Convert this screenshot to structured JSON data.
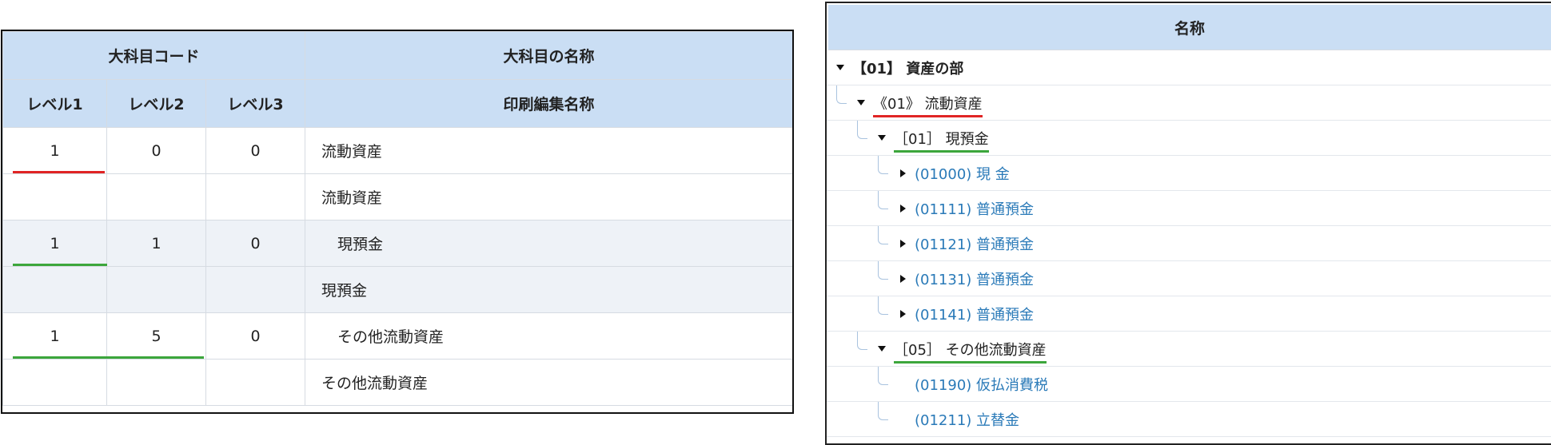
{
  "left_table": {
    "header_group": "大科目コード",
    "header_name": "大科目の名称",
    "level_headers": [
      "レベル1",
      "レベル2",
      "レベル3"
    ],
    "print_name_header": "印刷編集名称",
    "rows": [
      {
        "l1": "1",
        "l2": "0",
        "l3": "0",
        "name": "流動資産"
      },
      {
        "l1": "",
        "l2": "",
        "l3": "",
        "name": "流動資産"
      },
      {
        "l1": "1",
        "l2": "1",
        "l3": "0",
        "name": "現預金"
      },
      {
        "l1": "",
        "l2": "",
        "l3": "",
        "name": "現預金"
      },
      {
        "l1": "1",
        "l2": "5",
        "l3": "0",
        "name": "その他流動資産"
      },
      {
        "l1": "",
        "l2": "",
        "l3": "",
        "name": "その他流動資産"
      }
    ]
  },
  "tree": {
    "header": "名称",
    "nodes": [
      {
        "text": "【01】 資産の部",
        "caret": "down"
      },
      {
        "text": "《01》 流動資産",
        "caret": "down"
      },
      {
        "text": "［01］ 現預金",
        "caret": "down"
      },
      {
        "text": "(01000) 現 金",
        "caret": "right"
      },
      {
        "text": "(01111) 普通預金",
        "caret": "right"
      },
      {
        "text": "(01121) 普通預金",
        "caret": "right"
      },
      {
        "text": "(01131) 普通預金",
        "caret": "right"
      },
      {
        "text": "(01141) 普通預金",
        "caret": "right"
      },
      {
        "text": "［05］ その他流動資産",
        "caret": "down"
      },
      {
        "text": "(01190) 仮払消費税",
        "caret": "none"
      },
      {
        "text": "(01211) 立替金",
        "caret": "none"
      }
    ]
  },
  "colors": {
    "header_bg": "#cadef4",
    "link": "#2a7ab8",
    "highlight_red": "#e02424",
    "highlight_green": "#3ca63c"
  }
}
